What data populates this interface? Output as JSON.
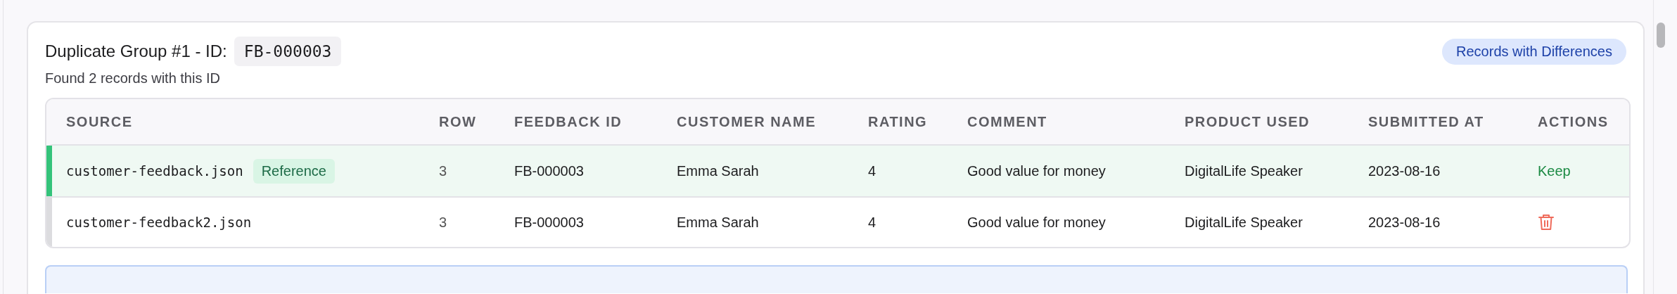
{
  "group": {
    "title": "Duplicate Group #1 - ID:",
    "id": "FB-000003",
    "status_badge": "Records with Differences",
    "summary": "Found 2 records with this ID"
  },
  "table": {
    "columns": [
      "SOURCE",
      "ROW",
      "FEEDBACK ID",
      "CUSTOMER NAME",
      "RATING",
      "COMMENT",
      "PRODUCT USED",
      "SUBMITTED AT",
      "ACTIONS"
    ],
    "rows": [
      {
        "reference": true,
        "cells": [
          {
            "file": "customer-feedback.json",
            "badge": "Reference"
          },
          "3",
          "FB-000003",
          "Emma Sarah",
          "4",
          "Good value for money",
          "DigitalLife Speaker",
          "2023-08-16",
          {
            "kind": "keep",
            "label": "Keep"
          }
        ]
      },
      {
        "reference": false,
        "cells": [
          {
            "file": "customer-feedback2.json"
          },
          "3",
          "FB-000003",
          "Emma Sarah",
          "4",
          "Good value for money",
          "DigitalLife Speaker",
          "2023-08-16",
          {
            "kind": "delete"
          }
        ]
      }
    ]
  }
}
